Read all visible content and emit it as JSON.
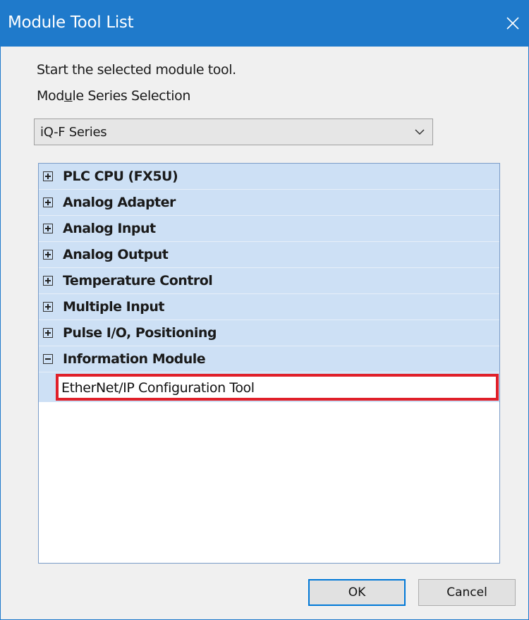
{
  "window": {
    "title": "Module Tool List",
    "close_icon": "close-icon"
  },
  "instructions": {
    "line1": "Start the selected module tool.",
    "series_label_pre": "Mod",
    "series_label_u": "u",
    "series_label_post": "le Series Selection"
  },
  "series_select": {
    "value": "iQ-F Series"
  },
  "tree": {
    "items": [
      {
        "label": "PLC CPU (FX5U)",
        "state": "collapsed"
      },
      {
        "label": "Analog Adapter",
        "state": "collapsed"
      },
      {
        "label": "Analog Input",
        "state": "collapsed"
      },
      {
        "label": "Analog Output",
        "state": "collapsed"
      },
      {
        "label": "Temperature Control",
        "state": "collapsed"
      },
      {
        "label": "Multiple Input",
        "state": "collapsed"
      },
      {
        "label": "Pulse I/O, Positioning",
        "state": "collapsed"
      },
      {
        "label": "Information Module",
        "state": "expanded"
      }
    ],
    "selected_child": {
      "label": "EtherNet/IP Configuration Tool"
    },
    "colors": {
      "row_bg": "#cde0f5",
      "highlight": "#e0202a"
    }
  },
  "buttons": {
    "ok": "OK",
    "cancel": "Cancel"
  },
  "colors": {
    "titlebar": "#1f7acb"
  }
}
